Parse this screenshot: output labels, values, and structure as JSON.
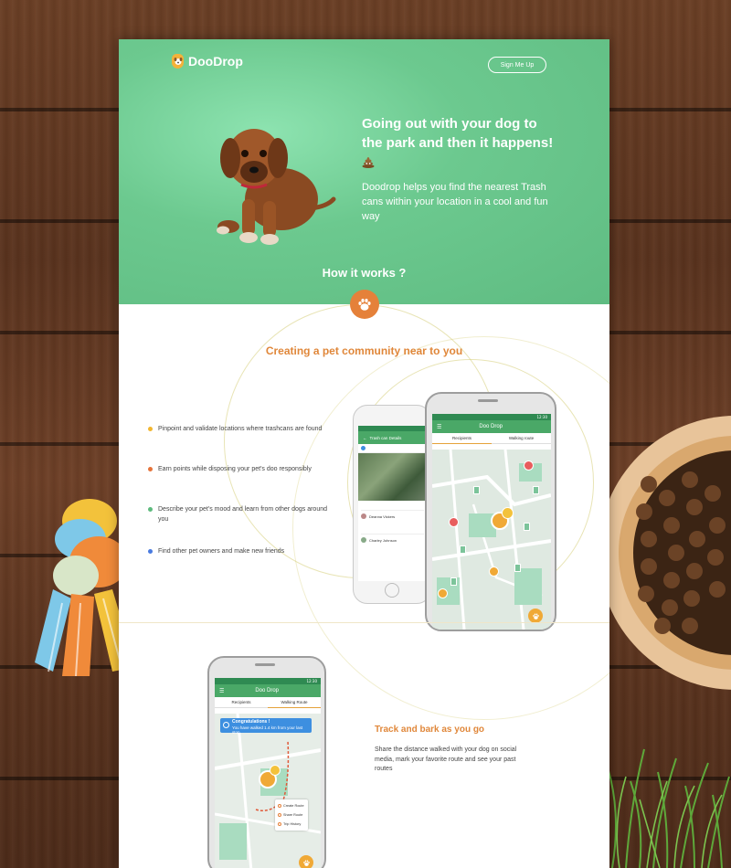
{
  "brand": {
    "name": "DooDrop"
  },
  "header": {
    "signup_label": "Sign Me Up"
  },
  "hero": {
    "title": "Going out with your dog to the park and then it happens!",
    "description": "Doodrop helps you find the nearest Trash cans within your location in a cool and fun way",
    "how_it_works": "How it works ?"
  },
  "community": {
    "title": "Creating a pet community near to you",
    "features": [
      {
        "text": "Pinpoint and validate locations where trashcans are found",
        "color": "#f2b62f"
      },
      {
        "text": "Earn points while disposing your pet's doo responsibly",
        "color": "#e5733a"
      },
      {
        "text": "Describe your pet's mood and learn from other dogs around you",
        "color": "#5dba7d"
      },
      {
        "text": "Find other pet owners and make new friends",
        "color": "#4a7be0"
      }
    ]
  },
  "phone_back": {
    "app_title": "Trash can Details",
    "user1": "Deanna Vickers",
    "user2": "Charley Johnson"
  },
  "phone_front": {
    "status_time": "12:30",
    "app_title": "Doo Drop",
    "tab1": "Recipients",
    "tab2": "Walking route"
  },
  "track": {
    "title": "Track and bark as you go",
    "description": "Share the distance walked with your dog on social media, mark your favorite route and see your past routes"
  },
  "phone_track": {
    "status_time": "12:30",
    "app_title": "Doo Drop",
    "tab1": "Recipients",
    "tab2": "Walking Route",
    "toast_title": "Congratulations !",
    "toast_body": "You have walked 1.4 km from your last stop",
    "menu": [
      "Create Route",
      "Share Route",
      "Trip History"
    ]
  },
  "colors": {
    "hero_green": "#6cc98f",
    "accent_orange": "#e5813a",
    "app_green": "#4aa867"
  }
}
